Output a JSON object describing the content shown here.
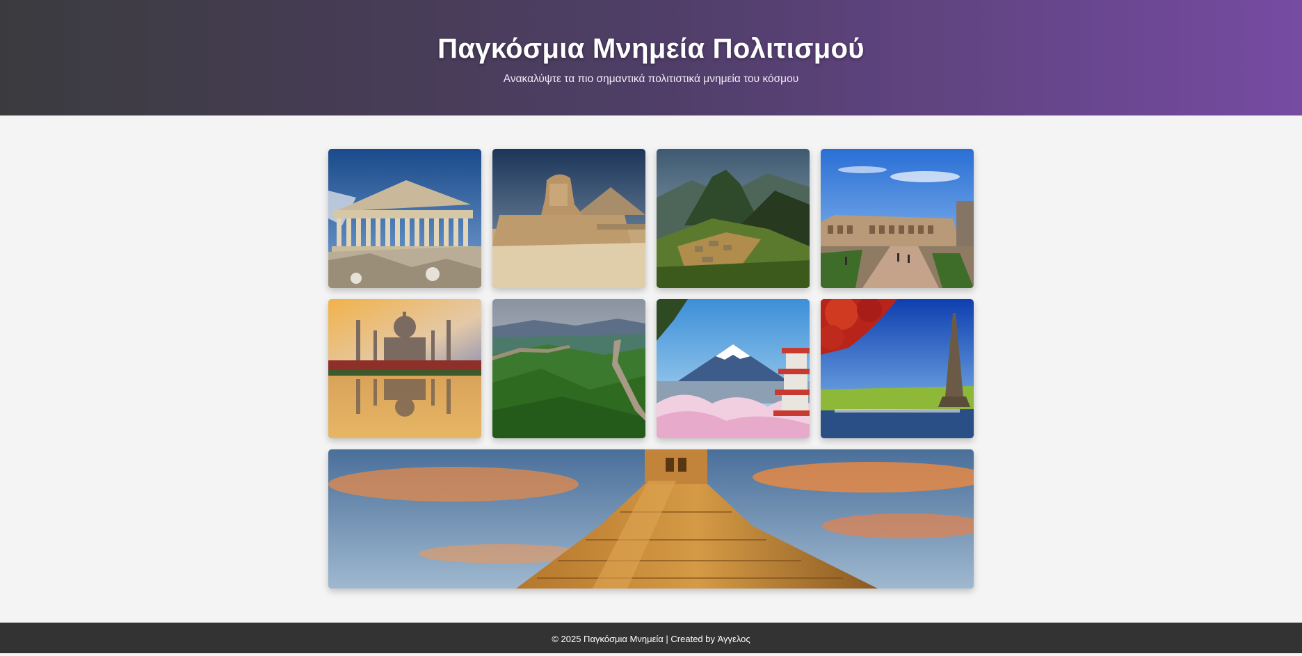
{
  "header": {
    "title": "Παγκόσμια Μνημεία Πολιτισμού",
    "subtitle": "Ανακαλύψτε τα πιο σημαντικά πολιτιστικά μνημεία του κόσμου"
  },
  "gallery": {
    "tiles": [
      {
        "id": "parthenon",
        "image": "parthenon-photo"
      },
      {
        "id": "sphinx",
        "image": "sphinx-photo"
      },
      {
        "id": "machu-picchu",
        "image": "machu-picchu-photo"
      },
      {
        "id": "colosseum",
        "image": "colosseum-photo"
      },
      {
        "id": "taj-mahal",
        "image": "taj-mahal-photo"
      },
      {
        "id": "great-wall",
        "image": "great-wall-photo"
      },
      {
        "id": "mount-fuji",
        "image": "mount-fuji-photo"
      },
      {
        "id": "eiffel-tower",
        "image": "eiffel-tower-photo"
      },
      {
        "id": "chichen-itza",
        "image": "chichen-itza-photo"
      }
    ]
  },
  "footer": {
    "text": "© 2025 Παγκόσμια Μνημεία | Created by Άγγελος"
  },
  "colors": {
    "header_gradient_start": "#3b3b3e",
    "header_gradient_end": "#764ba2",
    "page_background": "#f4f4f4",
    "footer_background": "#333333"
  }
}
